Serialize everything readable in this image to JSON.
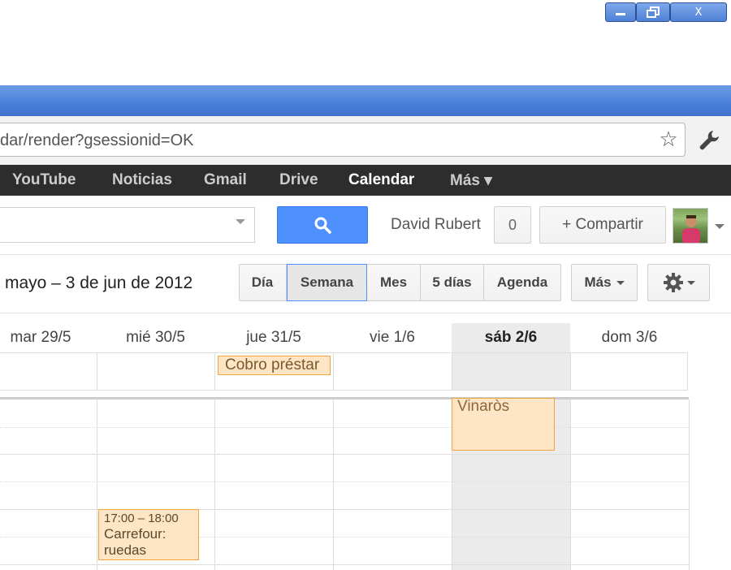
{
  "window": {
    "min_label": "—",
    "max_label": "⧉",
    "close_label": "X"
  },
  "browser": {
    "url": "dar/render?gsessionid=OK"
  },
  "google_bar": {
    "items": [
      "YouTube",
      "Noticias",
      "Gmail",
      "Drive",
      "Calendar",
      "Más ▾"
    ],
    "active": "Calendar"
  },
  "search": {
    "placeholder": "",
    "user_name": "David Rubert",
    "notification_count": "0",
    "share_label": "+ Compartir"
  },
  "toolbar": {
    "date_range": "mayo – 3 de jun de 2012",
    "views": [
      "Día",
      "Semana",
      "Mes",
      "5 días",
      "Agenda"
    ],
    "selected_view": "Semana",
    "more_label": "Más"
  },
  "days": [
    "mar 29/5",
    "mié 30/5",
    "jue 31/5",
    "vie 1/6",
    "sáb 2/6",
    "dom 3/6"
  ],
  "today": "sáb 2/6",
  "events": {
    "cobro": {
      "title": "Cobro préstar"
    },
    "vinaros": {
      "title": "Vinaròs"
    },
    "carrefour": {
      "time": "17:00 – 18:00",
      "title": "Carrefour: ruedas"
    }
  },
  "colors": {
    "event_bg": "#fde5c6",
    "event_border": "#f2a640",
    "search_button": "#4d90fe",
    "google_bar": "#2d2d2d",
    "title_bar": "#4a7fd8"
  }
}
